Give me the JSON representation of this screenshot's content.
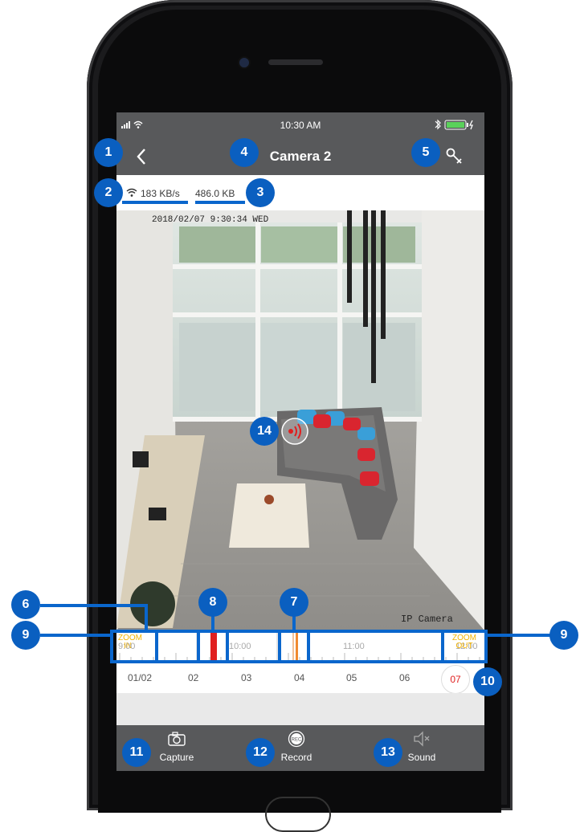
{
  "status_bar": {
    "time": "10:30 AM"
  },
  "nav": {
    "title": "Camera 2"
  },
  "stream": {
    "speed": "183 KB/s",
    "size": "486.0 KB"
  },
  "video": {
    "timestamp": "2018/02/07 9:30:34 WED",
    "watermark": "IP Camera"
  },
  "timeline": {
    "zoom_in": "ZOOM IN",
    "zoom_out": "ZOOM OUT",
    "times": [
      "9:00",
      "10:00",
      "11:00",
      "12:00"
    ]
  },
  "days": [
    "01/02",
    "02",
    "03",
    "04",
    "05",
    "06",
    "07"
  ],
  "toolbar": {
    "capture": "Capture",
    "record": "Record",
    "sound": "Sound"
  },
  "callouts": [
    "1",
    "2",
    "3",
    "4",
    "5",
    "6",
    "7",
    "8",
    "9",
    "10",
    "11",
    "12",
    "13",
    "14"
  ],
  "colors": {
    "callout": "#0a5fc0",
    "bar": "#58595b",
    "recording_mark": "#e02020",
    "motion_mark": "#f08a30"
  }
}
